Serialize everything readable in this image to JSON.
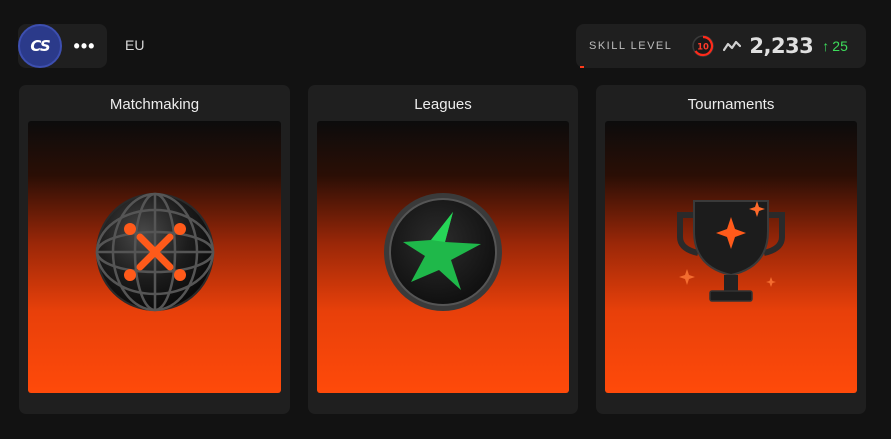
{
  "header": {
    "game_logo_text": "CS",
    "more_label": "•••",
    "region": "EU"
  },
  "skill": {
    "label": "SKILL LEVEL",
    "level": "10",
    "elo": "2,233",
    "delta_arrow": "↑",
    "delta": "25",
    "delta_color": "#3ddc5b",
    "level_color": "#ff2a1a"
  },
  "modes": [
    {
      "title": "Matchmaking",
      "icon": "matchmaking-globe-icon"
    },
    {
      "title": "Leagues",
      "icon": "leagues-star-coin-icon"
    },
    {
      "title": "Tournaments",
      "icon": "tournament-trophy-icon"
    }
  ],
  "colors": {
    "background": "#121212",
    "panel": "#1f1f1f",
    "accent_orange": "#ff4a0a",
    "leagues_green": "#1fb84a"
  }
}
